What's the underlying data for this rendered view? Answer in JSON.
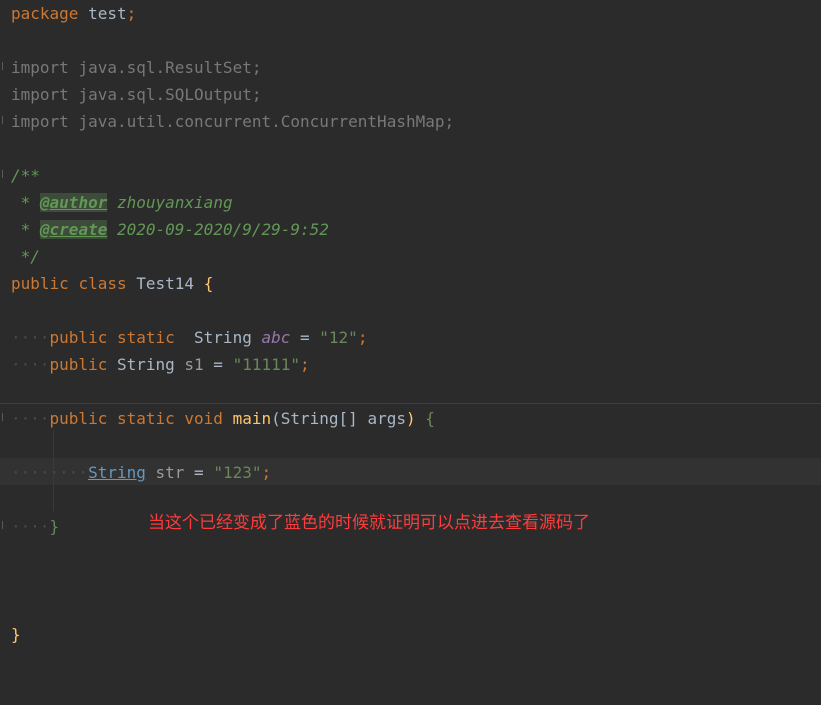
{
  "code": {
    "package_kw": "package",
    "package_name": "test",
    "import_kw": "import",
    "import1": "java.sql.ResultSet",
    "import2": "java.sql.SQLOutput",
    "import3": "java.util.concurrent.ConcurrentHashMap",
    "doc_open": "/**",
    "doc_star": " *",
    "doc_author_tag": "@author",
    "doc_author_val": "zhouyanxiang",
    "doc_create_tag": "@create",
    "doc_create_val": "2020-09-2020/9/29-9:52",
    "doc_close": " */",
    "public_kw": "public",
    "class_kw": "class",
    "class_name": "Test14",
    "static_kw": "static",
    "void_kw": "void",
    "string_type": "String",
    "field1_name": "abc",
    "field1_value": "\"12\"",
    "field2_name": "s1",
    "field2_value": "\"11111\"",
    "method_name": "main",
    "param_type": "String[]",
    "param_name": "args",
    "local_name": "str",
    "local_value": "\"123\""
  },
  "annotation_text": "当这个已经变成了蓝色的时候就证明可以点进去查看源码了",
  "colors": {
    "background": "#2b2b2b",
    "keyword": "#cc7832",
    "string": "#6a8759",
    "doc": "#629755",
    "annotation": "#ff3c3c",
    "link": "#6897bb"
  }
}
